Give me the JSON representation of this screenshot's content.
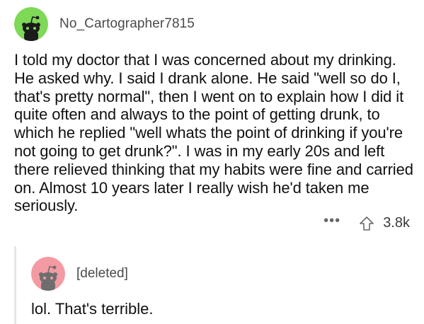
{
  "comment": {
    "username": "No_Cartographer7815",
    "avatar_color": "#7ed957",
    "avatar_icon": "snoo-avatar-icon",
    "body": "I told my doctor that I was concerned about my drinking. He asked why. I said I drank alone. He said \"well so do I, that's pretty normal\", then I went on to explain how I did it quite often and always to the point of getting drunk, to which he replied \"well whats the point of drinking if you're not going to get drunk?\". I was in my early 20s and left there relieved thinking that my habits were fine and carried on. Almost 10 years later I really wish he'd taken me seriously.",
    "more_label": "•••",
    "upvote_icon": "upvote-arrow-icon",
    "score": "3.8k"
  },
  "reply": {
    "username": "[deleted]",
    "avatar_color": "#f49aa2",
    "avatar_icon": "snoo-avatar-icon",
    "body": "lol. That's terrible."
  }
}
